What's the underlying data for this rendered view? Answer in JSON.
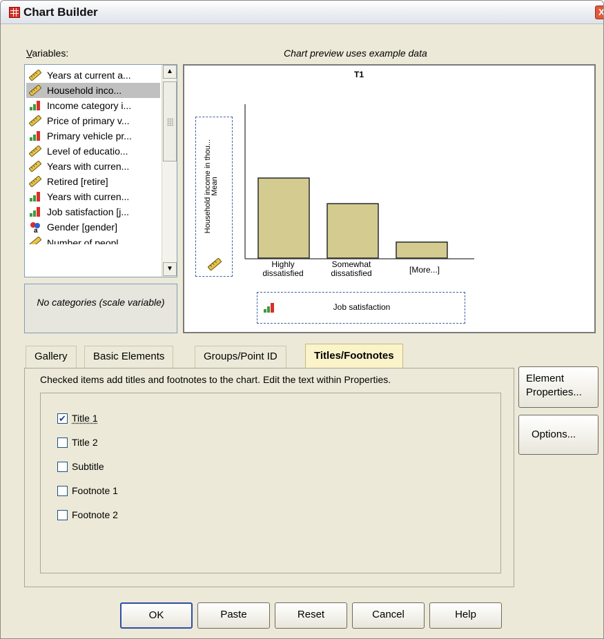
{
  "window": {
    "title": "Chart Builder",
    "close_glyph": "X"
  },
  "variables": {
    "label": "Variables:",
    "items": [
      {
        "label": "Years at current a...",
        "icon": "scale-icon",
        "selected": false
      },
      {
        "label": "Household inco...",
        "icon": "scale-icon",
        "selected": true
      },
      {
        "label": "Income category i...",
        "icon": "ordinal-icon",
        "selected": false
      },
      {
        "label": "Price of primary v...",
        "icon": "scale-icon",
        "selected": false
      },
      {
        "label": "Primary vehicle pr...",
        "icon": "ordinal-icon",
        "selected": false
      },
      {
        "label": "Level of educatio...",
        "icon": "scale-icon",
        "selected": false
      },
      {
        "label": "Years with curren...",
        "icon": "scale-icon",
        "selected": false
      },
      {
        "label": "Retired [retire]",
        "icon": "scale-icon",
        "selected": false
      },
      {
        "label": "Years with curren...",
        "icon": "ordinal-icon",
        "selected": false
      },
      {
        "label": "Job satisfaction [j...",
        "icon": "ordinal-icon",
        "selected": false
      },
      {
        "label": "Gender [gender]",
        "icon": "nominal-icon",
        "selected": false
      },
      {
        "label": "Number of peopl...",
        "icon": "scale-icon",
        "selected": false
      }
    ],
    "no_categories": "No categories (scale variable)"
  },
  "preview": {
    "caption": "Chart preview uses example data",
    "title": "T1",
    "y_axis_line1": "Mean",
    "y_axis_line2": "Household income in thou...",
    "x_axis_label": "Job satisfaction",
    "bars": [
      {
        "label_line1": "Highly",
        "label_line2": "dissatisfied",
        "value": 1.0
      },
      {
        "label_line1": "Somewhat",
        "label_line2": "dissatisfied",
        "value": 0.68
      },
      {
        "label_line1": "[More...]",
        "label_line2": "",
        "value": 0.2
      }
    ],
    "bar_color": "#d4cb90"
  },
  "tabs": [
    {
      "label": "Gallery",
      "active": false
    },
    {
      "label": "Basic Elements",
      "active": false
    },
    {
      "label": "Groups/Point ID",
      "active": false
    },
    {
      "label": "Titles/Footnotes",
      "active": true
    }
  ],
  "titles_panel": {
    "instruction": "Checked items add titles and footnotes to the chart. Edit the text within Properties.",
    "options": [
      {
        "label": "Title 1",
        "checked": true
      },
      {
        "label": "Title 2",
        "checked": false
      },
      {
        "label": "Subtitle",
        "checked": false
      },
      {
        "label": "Footnote 1",
        "checked": false
      },
      {
        "label": "Footnote 2",
        "checked": false
      }
    ]
  },
  "side_buttons": {
    "element_properties_line1": "Element",
    "element_properties_line2": "Properties...",
    "options": "Options..."
  },
  "buttons": {
    "ok": "OK",
    "paste": "Paste",
    "reset": "Reset",
    "cancel": "Cancel",
    "help": "Help"
  }
}
